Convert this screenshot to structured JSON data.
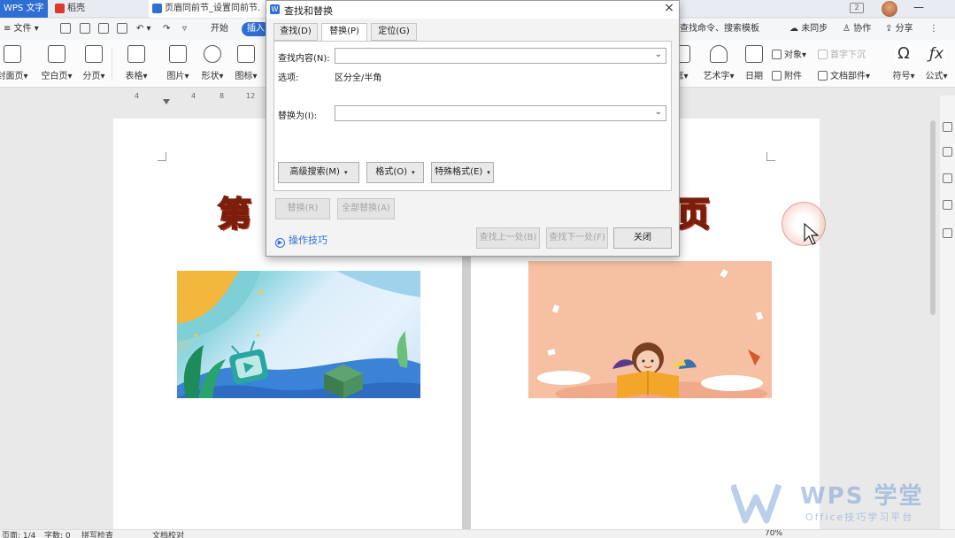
{
  "titlebar": {
    "app_label": "WPS 文字",
    "tab1": "稻壳",
    "tab2": "页眉同前节_设置同前节.",
    "box_label": "2"
  },
  "menu": {
    "file": "≡ 文件 ▾",
    "start": "开始",
    "insert": "插入",
    "search_hint": "查找命令、搜索模板",
    "unsynced": "未同步",
    "collab": "协作",
    "share": "分享"
  },
  "ribbon": {
    "left": [
      {
        "label": "封面页▾"
      },
      {
        "label": "空白页▾"
      },
      {
        "label": "分页▾"
      },
      {
        "label": "表格▾"
      },
      {
        "label": "图片▾"
      },
      {
        "label": "形状▾"
      },
      {
        "label": "图标▾"
      }
    ],
    "right": [
      {
        "label": "框▾"
      },
      {
        "label": "艺术字▾"
      },
      {
        "label": "日期"
      },
      {
        "label": "符号▾"
      },
      {
        "label": "公式▾"
      }
    ],
    "object": "对象▾",
    "attachment": "附件",
    "dropcap": "首字下沉",
    "docparts": "文档部件▾"
  },
  "ruler": [
    "4",
    "4",
    "8",
    "12"
  ],
  "dialog": {
    "title": "查找和替换",
    "tabs": [
      {
        "label": "查找(D)"
      },
      {
        "label": "替换(P)"
      },
      {
        "label": "定位(G)"
      }
    ],
    "find_label": "查找内容(N):",
    "find_value": "",
    "options_label": "选项:",
    "options_value": "区分全/半角",
    "replace_label": "替换为(I):",
    "replace_value": "",
    "advanced_search": "高级搜索(M)",
    "format": "格式(O)",
    "special_format": "特殊格式(E)",
    "replace_btn": "替换(R)",
    "replace_all_btn": "全部替换(A)",
    "tips": "操作技巧",
    "find_prev": "查找上一处(B)",
    "find_next": "查找下一处(F)",
    "close": "关闭",
    "close_glyph": "×"
  },
  "document": {
    "title_chars_left": [
      "第"
    ],
    "title_chars_right": [
      "页"
    ]
  },
  "statusbar": {
    "page": "页面: 1/4",
    "words": "字数: 0",
    "spellcheck": "拼写检查",
    "proofread": "文档校对",
    "zoom": "70%"
  },
  "watermark": {
    "brand": "WPS 学堂",
    "sub": "Office技巧学习平台"
  },
  "colors": {
    "accent": "#2f6fd3",
    "title_art": "#f39c12"
  }
}
